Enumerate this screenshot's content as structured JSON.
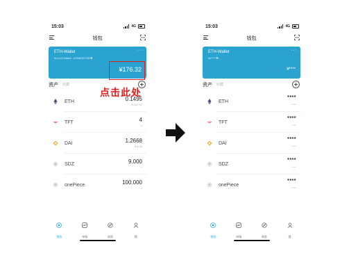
{
  "screens": [
    {
      "status": {
        "time": "15:03",
        "network": "4G"
      },
      "nav": {
        "title": "钱包"
      },
      "wallet": {
        "name": "ETH-Wallet",
        "address": "0xCc2144ab6...426AE30799",
        "balance": "¥176.32",
        "more": "···"
      },
      "assets": {
        "title": "资产",
        "subtitle": "收藏"
      },
      "tokens": [
        {
          "name": "ETH",
          "amount": "0.1495",
          "fiat": "¥ 167.97",
          "icon": "eth-icon"
        },
        {
          "name": "TFT",
          "amount": "4",
          "fiat": "≈",
          "icon": "tft-icon"
        },
        {
          "name": "DAI",
          "amount": "1.2668",
          "fiat": "¥ 8.35",
          "icon": "dai-icon"
        },
        {
          "name": "SDZ",
          "amount": "9.000",
          "fiat": "≈",
          "icon": "sdz-icon"
        },
        {
          "name": "onePiece",
          "amount": "100.000",
          "fiat": "≈",
          "icon": "onepiece-icon"
        }
      ],
      "tabs": [
        "钱包",
        "市场",
        "浏览",
        "我"
      ]
    },
    {
      "status": {
        "time": "15:03",
        "network": "4G"
      },
      "nav": {
        "title": "钱包"
      },
      "wallet": {
        "name": "ETH-Wallet",
        "address": "0x****",
        "balance": "¥****",
        "more": "···"
      },
      "assets": {
        "title": "资产",
        "subtitle": "收藏"
      },
      "tokens": [
        {
          "name": "ETH",
          "amount": "****",
          "fiat": "****",
          "icon": "eth-icon"
        },
        {
          "name": "TFT",
          "amount": "****",
          "fiat": "****",
          "icon": "tft-icon"
        },
        {
          "name": "DAI",
          "amount": "****",
          "fiat": "****",
          "icon": "dai-icon"
        },
        {
          "name": "SDZ",
          "amount": "****",
          "fiat": "****",
          "icon": "sdz-icon"
        },
        {
          "name": "onePiece",
          "amount": "****",
          "fiat": "****",
          "icon": "onepiece-icon"
        }
      ],
      "tabs": [
        "钱包",
        "市场",
        "浏览",
        "我"
      ]
    }
  ],
  "annotation": {
    "text": "点击此处"
  },
  "colors": {
    "accent": "#2aa3d1",
    "annotation": "#e02020"
  }
}
